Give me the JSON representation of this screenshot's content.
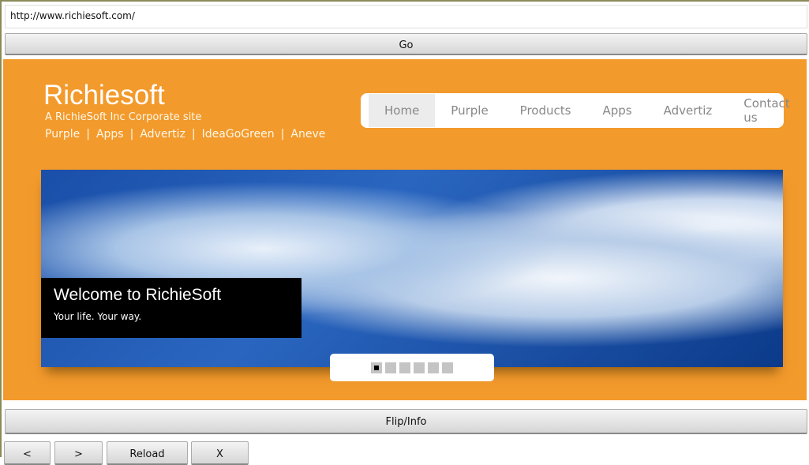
{
  "browser": {
    "url": "http://www.richiesoft.com/",
    "go": "Go",
    "flip": "Flip/Info",
    "back": "<",
    "forward": ">",
    "reload": "Reload",
    "close": "X"
  },
  "site": {
    "logo": "Richiesoft",
    "tagline": "A RichieSoft Inc Corporate site",
    "links": [
      "Purple",
      "|",
      "Apps",
      "|",
      "Advertiz",
      "|",
      "IdeaGoGreen",
      "|",
      "Aneve"
    ],
    "nav": [
      "Home",
      "Purple",
      "Products",
      "Apps",
      "Advertiz",
      "Contact us"
    ],
    "banner": {
      "title": "Welcome to RichieSoft",
      "subtitle": "Your life. Your way.",
      "slides": 6,
      "active_slide": 1
    },
    "colors": {
      "background": "#f39a2c"
    }
  }
}
